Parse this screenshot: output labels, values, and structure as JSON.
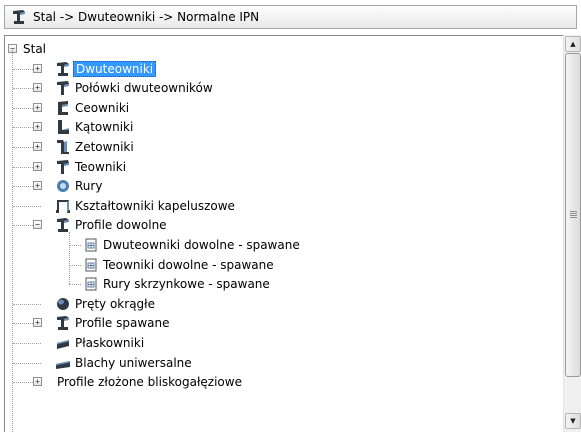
{
  "header": {
    "path": "Stal -> Dwuteowniki -> Normalne IPN",
    "icon": "ibeam-icon"
  },
  "tree": {
    "root": {
      "label": "Stal",
      "expander": "⊟"
    },
    "items": [
      {
        "label": "Dwuteowniki",
        "icon": "ibeam-icon",
        "expander": "+",
        "selected": true
      },
      {
        "label": "Połówki dwuteowników",
        "icon": "tee-icon",
        "expander": "+"
      },
      {
        "label": "Ceowniki",
        "icon": "channel-icon",
        "expander": "+"
      },
      {
        "label": "Kątowniki",
        "icon": "angle-icon",
        "expander": "+"
      },
      {
        "label": "Zetowniki",
        "icon": "zsection-icon",
        "expander": "+"
      },
      {
        "label": "Teowniki",
        "icon": "tee-icon",
        "expander": "+"
      },
      {
        "label": "Rury",
        "icon": "pipe-icon",
        "expander": "+"
      },
      {
        "label": "Kształtowniki kapeluszowe",
        "icon": "hat-icon",
        "expander": ""
      },
      {
        "label": "Profile dowolne",
        "icon": "ibeam-icon",
        "expander": "−"
      },
      {
        "label": "Dwuteowniki dowolne - spawane",
        "icon": "document-icon",
        "expander": ""
      },
      {
        "label": "Teowniki dowolne - spawane",
        "icon": "document-icon",
        "expander": ""
      },
      {
        "label": "Rury skrzynkowe - spawane",
        "icon": "document-icon",
        "expander": ""
      },
      {
        "label": "Pręty okrągłe",
        "icon": "round-bar-icon",
        "expander": ""
      },
      {
        "label": "Profile spawane",
        "icon": "ibeam-icon",
        "expander": "+"
      },
      {
        "label": "Płaskowniki",
        "icon": "flat-bar-icon",
        "expander": ""
      },
      {
        "label": "Blachy uniwersalne",
        "icon": "plate-icon",
        "expander": ""
      },
      {
        "label": "Profile złożone bliskogałęziowe",
        "icon": "",
        "expander": "+"
      }
    ]
  },
  "scrollbar": {
    "up": "▲",
    "down": "▼"
  },
  "colors": {
    "selection": "#3399ff",
    "border": "#828790",
    "icon_dark": "#2f3a44",
    "icon_blue": "#4a7fb5"
  }
}
